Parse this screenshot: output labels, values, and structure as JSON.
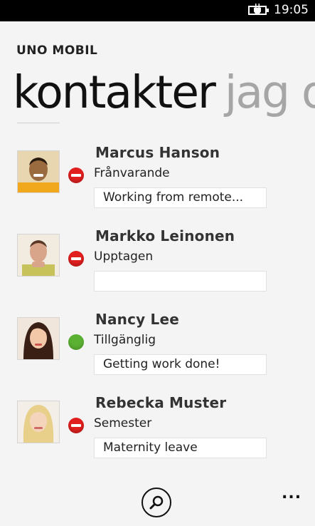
{
  "status_bar": {
    "time": "19:05",
    "battery_icon": "battery-charging-icon"
  },
  "app": {
    "title": "UNO MOBIL"
  },
  "pivot": {
    "active": "kontakter",
    "next": "jag o"
  },
  "contacts": [
    {
      "name": "Marcus Hanson",
      "presence": "Frånvarande",
      "status": "busy",
      "note": "Working from remote..."
    },
    {
      "name": "Markko Leinonen",
      "presence": "Upptagen",
      "status": "busy",
      "note": ""
    },
    {
      "name": "Nancy Lee",
      "presence": "Tillgänglig",
      "status": "available",
      "note": "Getting work done!"
    },
    {
      "name": "Rebecka Muster",
      "presence": "Semester",
      "status": "busy",
      "note": "Maternity leave"
    }
  ],
  "app_bar": {
    "search_icon": "search-icon",
    "more_label": "..."
  },
  "colors": {
    "busy": "#e21f1f",
    "available": "#5bb132",
    "background": "#f4f4f4"
  }
}
